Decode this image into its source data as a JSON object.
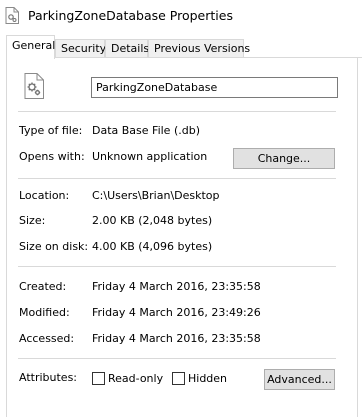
{
  "window": {
    "title": "ParkingZoneDatabase Properties",
    "icon": "database-file-icon"
  },
  "tabs": [
    "General",
    "Security",
    "Details",
    "Previous Versions"
  ],
  "active_tab": "General",
  "file": {
    "name": "ParkingZoneDatabase",
    "icon": "gears-file-icon"
  },
  "type": {
    "label": "Type of file:",
    "value": "Data Base File (.db)"
  },
  "opens": {
    "label": "Opens with:",
    "value": "Unknown application",
    "button": "Change..."
  },
  "location": {
    "label": "Location:",
    "value": "C:\\Users\\Brian\\Desktop"
  },
  "size": {
    "label": "Size:",
    "value": "2.00 KB (2,048 bytes)"
  },
  "size_on_disk": {
    "label": "Size on disk:",
    "value": "4.00 KB (4,096 bytes)"
  },
  "created": {
    "label": "Created:",
    "value": "Friday 4 March 2016, 23:35:58"
  },
  "modified": {
    "label": "Modified:",
    "value": "Friday 4 March 2016, 23:49:26"
  },
  "accessed": {
    "label": "Accessed:",
    "value": "Friday 4 March 2016, 23:35:58"
  },
  "attributes": {
    "label": "Attributes:",
    "readonly": {
      "label": "Read-only",
      "checked": false
    },
    "hidden": {
      "label": "Hidden",
      "checked": false
    },
    "advanced": "Advanced..."
  }
}
